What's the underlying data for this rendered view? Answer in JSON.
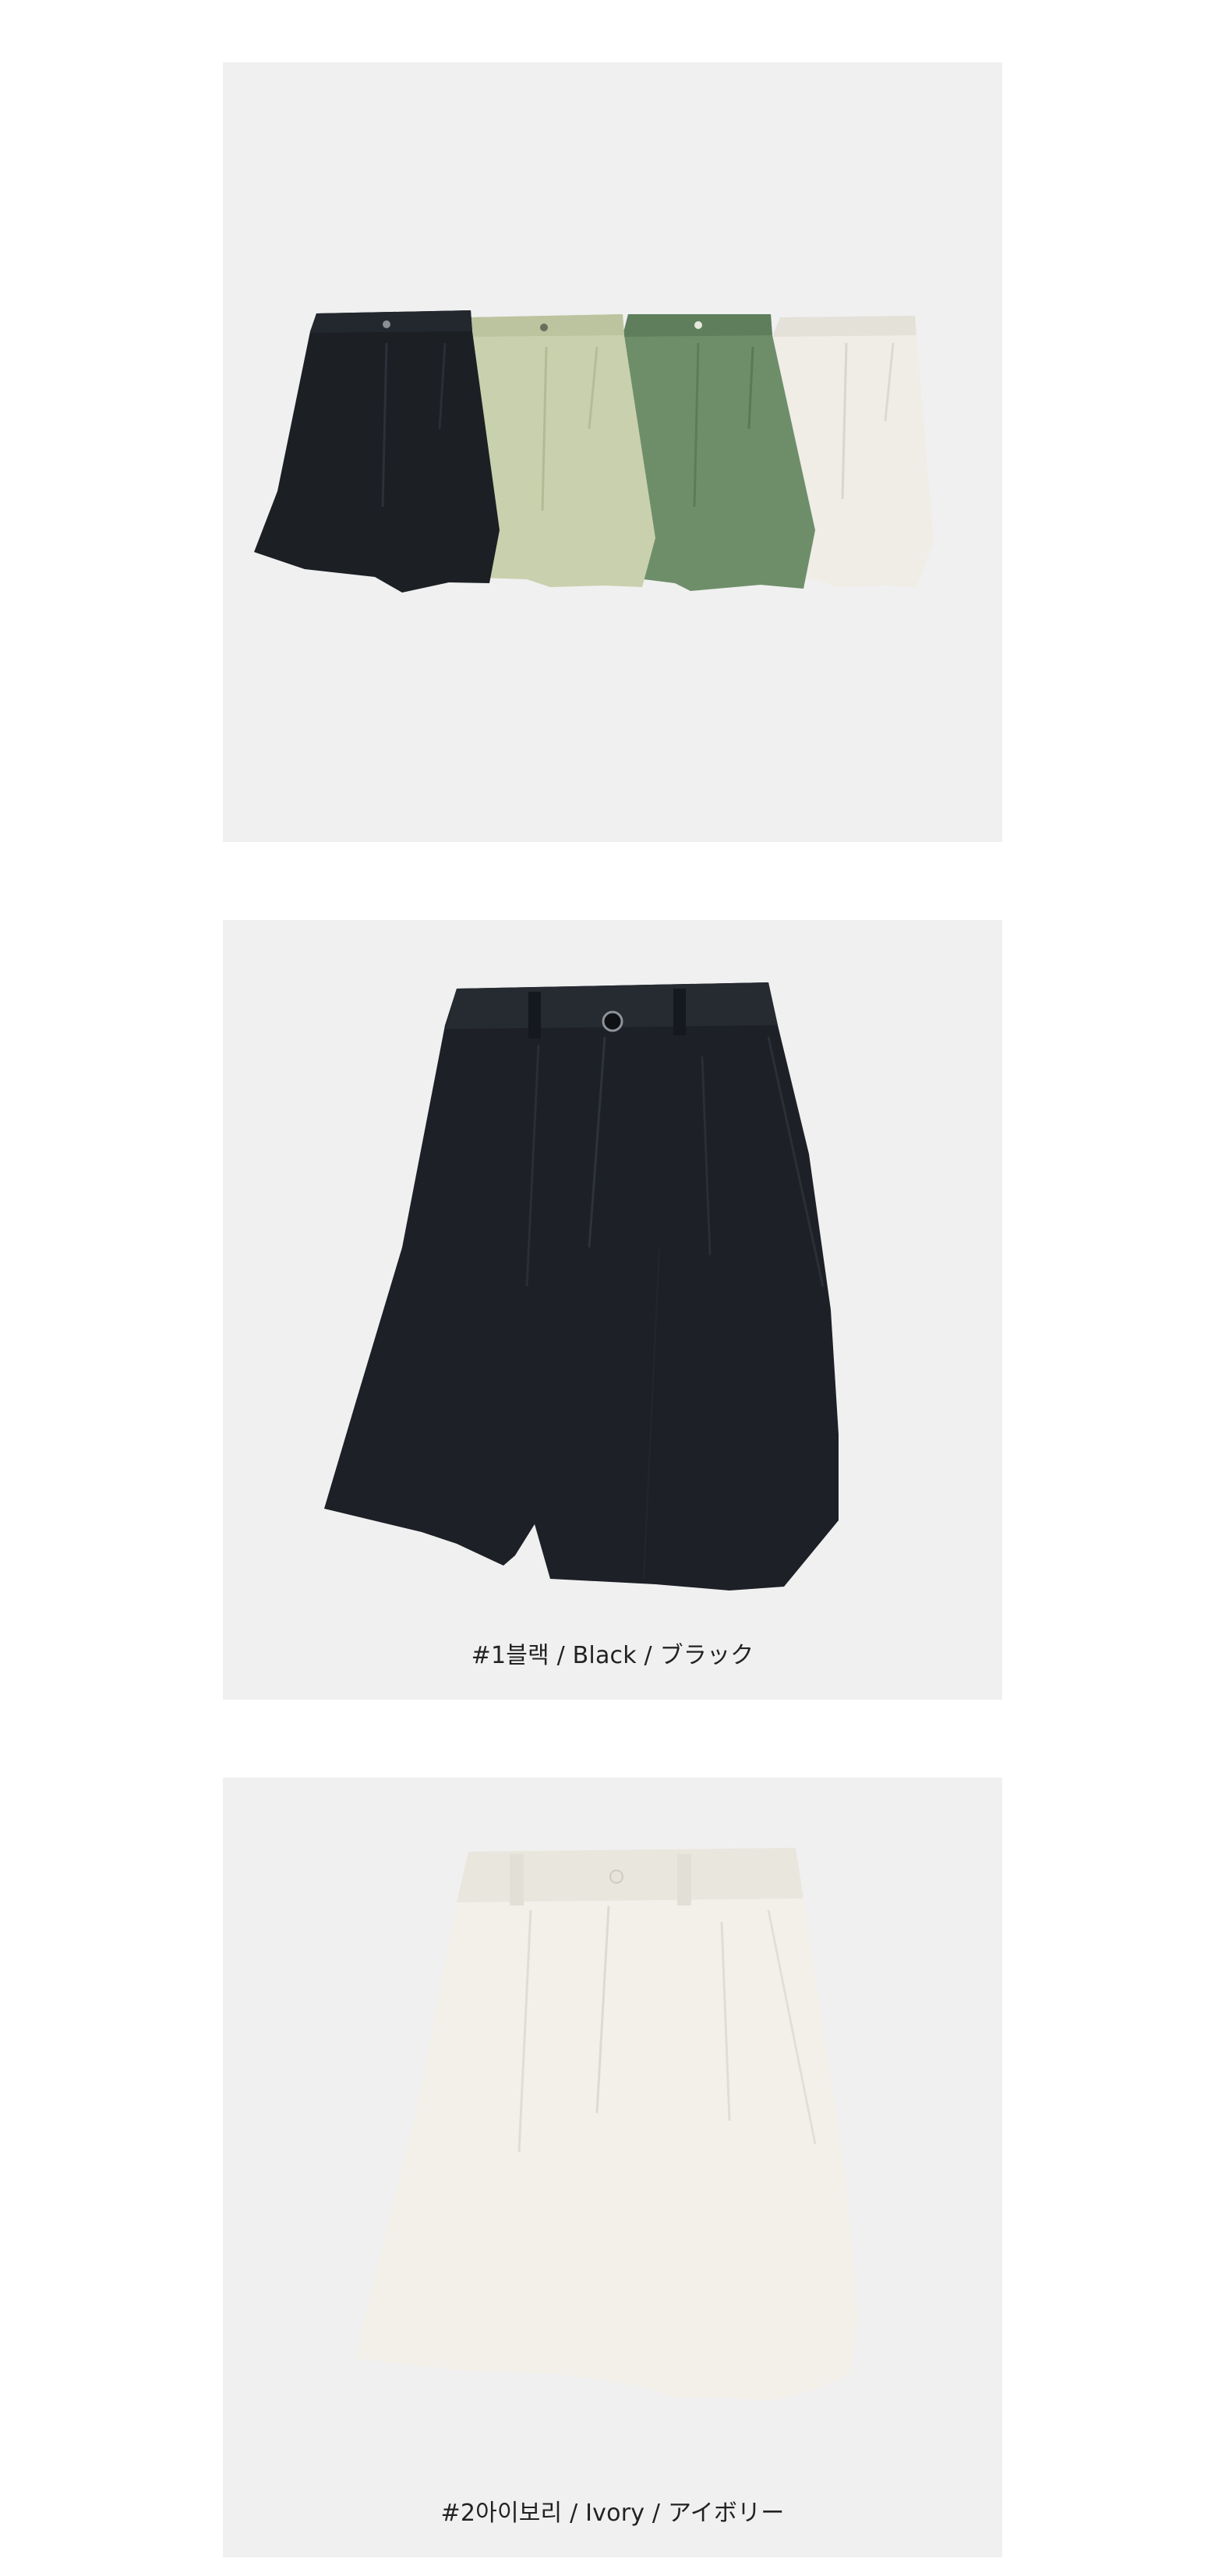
{
  "products": [
    {
      "caption": "",
      "image": "shorts-group-photo",
      "colors": [
        "#1c1f24",
        "#c8cfab",
        "#6b8b67",
        "#f1efe8"
      ]
    },
    {
      "caption": "#1블랙 / Black / ブラック",
      "image": "black-shorts-photo",
      "color": "#1d2026"
    },
    {
      "caption": "#2아이보리 / Ivory / アイボリー",
      "image": "ivory-shorts-photo",
      "color": "#f2f0e9"
    }
  ]
}
